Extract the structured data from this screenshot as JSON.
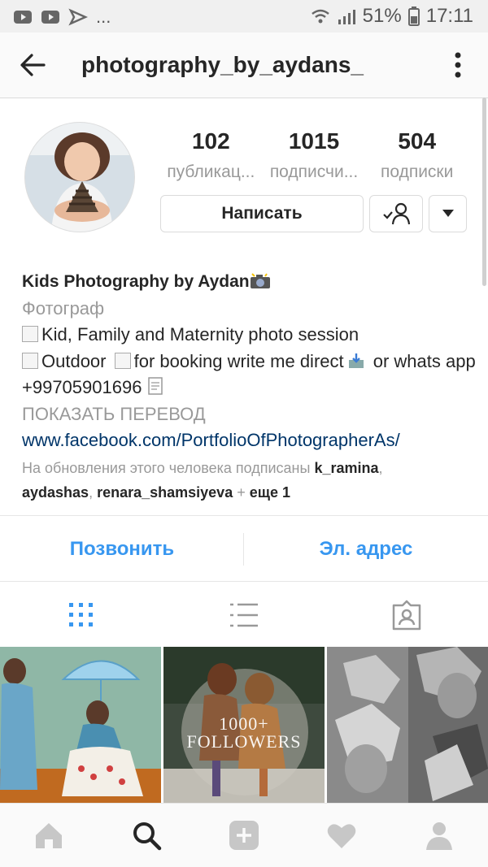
{
  "status_bar": {
    "battery": "51%",
    "time": "17:11",
    "more": "..."
  },
  "header": {
    "username": "photography_by_aydans_"
  },
  "stats": [
    {
      "value": "102",
      "label": "публикац..."
    },
    {
      "value": "1015",
      "label": "подписчи..."
    },
    {
      "value": "504",
      "label": "подписки"
    }
  ],
  "buttons": {
    "message": "Написать"
  },
  "bio": {
    "name": "Kids Photography by Aydan",
    "category": "Фотограф",
    "line1": "Kid, Family and Maternity photo session",
    "line2a": "Outdoor",
    "line2b": "for booking write me direct",
    "line2c": "or whats app +99705901696",
    "translate": "ПОКАЗАТЬ ПЕРЕВОД",
    "link": "www.facebook.com/PortfolioOfPhotographerAs/"
  },
  "followed_by": {
    "prefix": "На обновления этого человека подписаны",
    "user1": "k_ramina",
    "user2": "aydashas",
    "user3": "renara_shamsiyeva",
    "plus": "+",
    "more": "еще 1"
  },
  "contact": {
    "call": "Позвонить",
    "email": "Эл. адрес"
  },
  "grid": {
    "tile2_text": "1000+ FOLLOWERS"
  },
  "colors": {
    "accent": "#3897f0",
    "link": "#003569",
    "muted": "#999999"
  },
  "icons": {
    "tab_grid": "grid-icon",
    "tab_list": "list-icon",
    "tab_tagged": "tagged-icon",
    "nav": [
      "home-icon",
      "search-icon",
      "add-icon",
      "heart-icon",
      "profile-icon"
    ]
  }
}
